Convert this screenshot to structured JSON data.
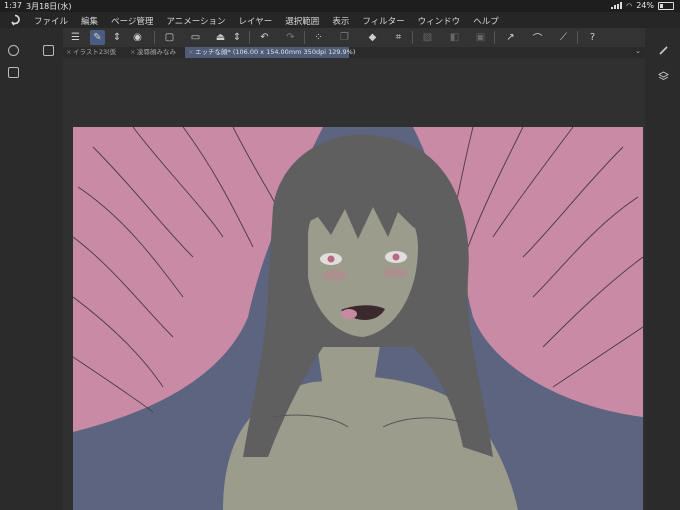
{
  "status_bar": {
    "time": "1:37",
    "date": "3月18日(水)",
    "battery": "24%"
  },
  "menu": {
    "items": [
      "ファイル",
      "編集",
      "ページ管理",
      "アニメーション",
      "レイヤー",
      "選択範囲",
      "表示",
      "フィルター",
      "ウィンドウ",
      "ヘルプ"
    ]
  },
  "tabs": [
    {
      "label": "イラスト23(仮",
      "active": false
    },
    {
      "label": "凌辱顔みなみ",
      "active": false
    },
    {
      "label": "エッチな顔* (106.00 x 154.00mm 350dpi 129.9%)",
      "active": true
    }
  ],
  "colors": {
    "accent": "#4f5c78",
    "curtain": "#c98aa6",
    "background_wall": "#5c6480",
    "skin": "#9b9c8c",
    "hair": "#5f5f5f"
  }
}
